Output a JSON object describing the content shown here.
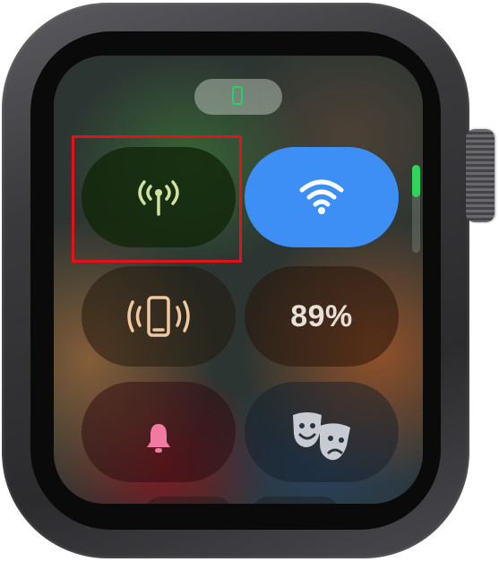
{
  "status_pill": {
    "icon": "phone-connected-icon",
    "accent": "#21d36a"
  },
  "controls": {
    "cellular": {
      "icon": "cellular-antenna-icon",
      "state": "off",
      "color": "#cfe0a0"
    },
    "wifi": {
      "icon": "wifi-icon",
      "state": "on",
      "color": "#3d8ef5"
    },
    "ping_iphone": {
      "icon": "ping-iphone-icon"
    },
    "battery": {
      "label": "89%"
    },
    "silent_mode": {
      "icon": "bell-icon",
      "color": "#f07aa0"
    },
    "theater_mode": {
      "icon": "theater-masks-icon"
    }
  },
  "scroll": {
    "position": 0.0,
    "accent": "#2fd45a"
  },
  "annotation": {
    "highlight_color": "#e4101b",
    "target": "cellular"
  }
}
